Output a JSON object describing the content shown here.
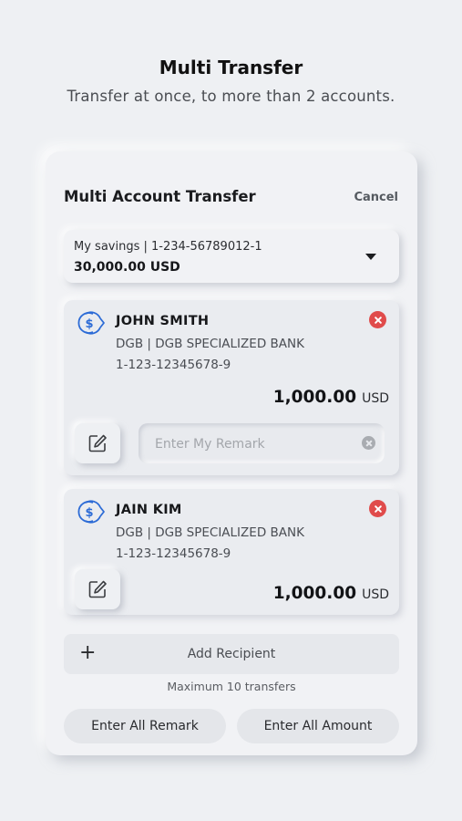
{
  "hero": {
    "title": "Multi Transfer",
    "subtitle": "Transfer at once, to more than 2 accounts."
  },
  "panel": {
    "title": "Multi Account Transfer",
    "cancel_label": "Cancel"
  },
  "source_account": {
    "line": "My savings | 1-234-56789012-1",
    "balance": "30,000.00 USD"
  },
  "recipients": [
    {
      "name": "JOHN SMITH",
      "bank": "DGB |  DGB SPECIALIZED BANK",
      "account": "1-123-12345678-9",
      "amount": "1,000.00",
      "currency": "USD",
      "remark_placeholder": "Enter My Remark"
    },
    {
      "name": "JAIN KIM",
      "bank": "DGB |  DGB SPECIALIZED BANK",
      "account": "1-123-12345678-9",
      "amount": "1,000.00",
      "currency": "USD"
    }
  ],
  "add_recipient": {
    "label": "Add Recipient",
    "limit_note": "Maximum 10 transfers"
  },
  "actions": {
    "enter_all_remark": "Enter All Remark",
    "enter_all_amount": "Enter All Amount"
  },
  "icons": {
    "transfer": "dollar-transfer-icon",
    "remove": "remove-circle-icon",
    "edit": "edit-pencil-icon",
    "clear": "clear-circle-icon",
    "plus": "plus-icon",
    "dropdown": "caret-down-icon"
  },
  "colors": {
    "background": "#eef0f3",
    "accent_blue": "#2c6bd6",
    "remove_red": "#e04b4b"
  }
}
